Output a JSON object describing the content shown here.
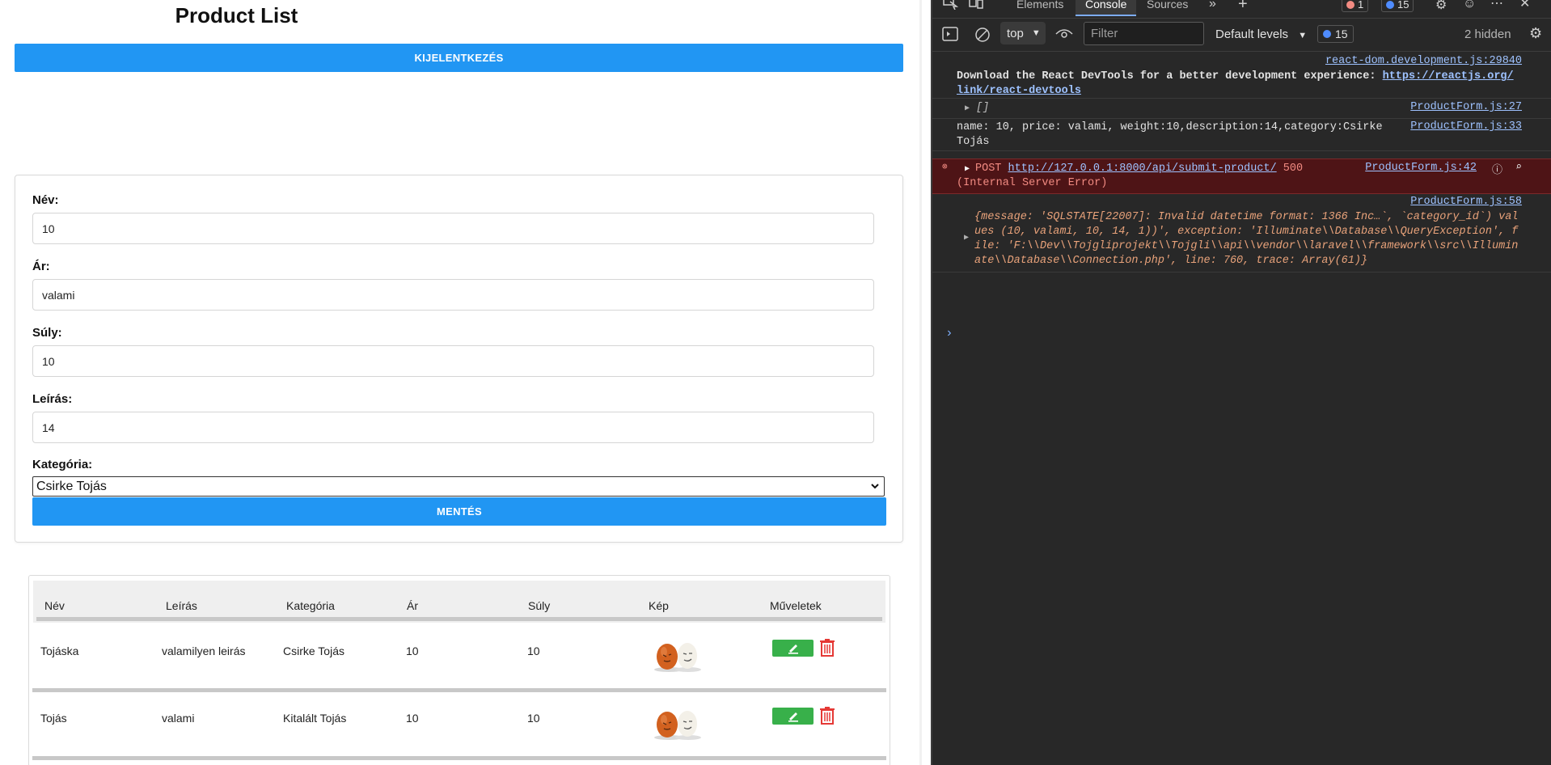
{
  "app": {
    "title": "Product List",
    "logout_label": "KIJELENTKEZÉS",
    "form": {
      "fields": [
        {
          "label": "Név:",
          "value": "10"
        },
        {
          "label": "Ár:",
          "value": "valami"
        },
        {
          "label": "Súly:",
          "value": "10"
        },
        {
          "label": "Leírás:",
          "value": "14"
        }
      ],
      "category_label": "Kategória:",
      "category_value": "Csirke Tojás",
      "save_label": "MENTÉS"
    },
    "table": {
      "headers": [
        "Név",
        "Leírás",
        "Kategória",
        "Ár",
        "Súly",
        "Kép",
        "Műveletek"
      ],
      "rows": [
        {
          "name": "Tojáska",
          "description": "valamilyen leirás",
          "category": "Csirke Tojás",
          "price": "10",
          "weight": "10"
        },
        {
          "name": "Tojás",
          "description": "valami",
          "category": "Kitalált Tojás",
          "price": "10",
          "weight": "10"
        }
      ]
    }
  },
  "devtools": {
    "tabs": [
      "Elements",
      "Console",
      "Sources"
    ],
    "active_tab": "Console",
    "error_count": "1",
    "message_count": "15",
    "context": "top",
    "filter_placeholder": "Filter",
    "levels_label": "Default levels",
    "levels_badge": "15",
    "hidden_label": "2 hidden",
    "console": {
      "msg1_source": "react-dom.development.js:29840",
      "msg1_text": "Download the React DevTools for a better development experience: ",
      "msg1_link_a": "https://reactjs.org/",
      "msg1_link_b": "link/react-devtools",
      "msg2_source": "ProductForm.js:27",
      "msg2_text": "[]",
      "msg3_source": "ProductForm.js:33",
      "msg3_line1": "name: 10, price: valami, weight:10,description:14,category:Csirke",
      "msg3_line2": "Tojás",
      "err_method": "POST",
      "err_url": "http://127.0.0.1:8000/api/submit-product/",
      "err_status": "500",
      "err_line2": "(Internal Server Error)",
      "err_source": "ProductForm.js:42",
      "msg5_source": "ProductForm.js:58",
      "msg5_line1": "{message: 'SQLSTATE[22007]: Invalid datetime format: 1366 Inc…`, `category_id`) val",
      "msg5_line2": "ues (10, valami, 10, 14, 1))', exception: 'Illuminate\\\\Database\\\\QueryException', f",
      "msg5_line3": "ile: 'F:\\\\Dev\\\\Tojgliprojekt\\\\Tojgli\\\\api\\\\vendor\\\\laravel\\\\framework\\\\src\\\\Illumin",
      "msg5_line4": "ate\\\\Database\\\\Connection.php', line: 760, trace: Array(61)}"
    }
  },
  "colors": {
    "primary": "#2196f3",
    "edit": "#38b04a",
    "delete": "#e53935",
    "devtools_bg": "#282828",
    "error_bg": "#4e1416"
  }
}
